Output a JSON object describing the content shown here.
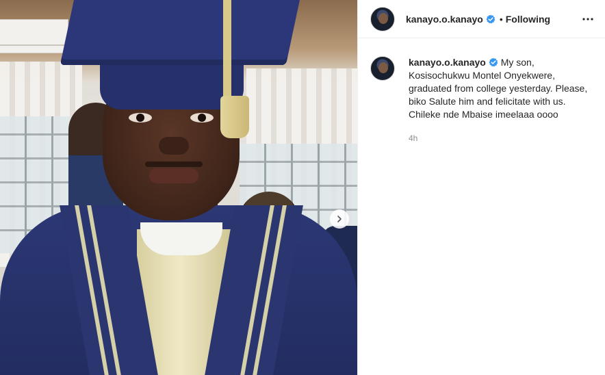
{
  "post": {
    "username": "kanayo.o.kanayo",
    "separator": "•",
    "follow_status": "Following",
    "caption": "My son, Kosisochukwu Montel Onyekwere, graduated from college yesterday. Please, biko Salute him and felicitate with us. Chileke nde Mbaise imeelaaa oooo",
    "timestamp": "4h"
  },
  "icons": {
    "verified": "verified-badge-icon",
    "more": "more-options-icon",
    "next": "chevron-right-icon"
  },
  "colors": {
    "verified": "#3897f0",
    "text": "#262626",
    "muted": "#8e8e8e"
  }
}
